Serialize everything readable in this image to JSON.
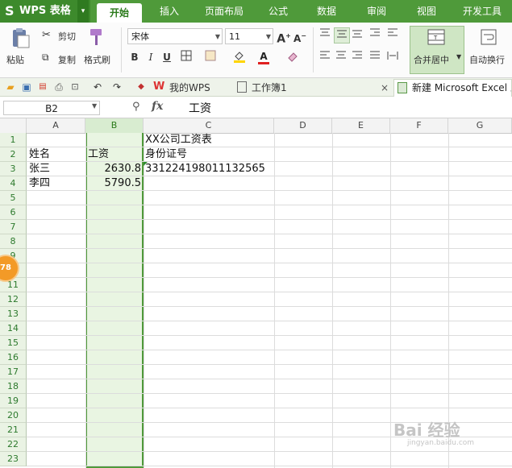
{
  "app": {
    "logo": "S",
    "name": "WPS 表格",
    "menu_arrow": "▾"
  },
  "menu_tabs": [
    {
      "label": "开始",
      "active": true
    },
    {
      "label": "插入"
    },
    {
      "label": "页面布局"
    },
    {
      "label": "公式"
    },
    {
      "label": "数据"
    },
    {
      "label": "审阅"
    },
    {
      "label": "视图"
    },
    {
      "label": "开发工具"
    }
  ],
  "ribbon": {
    "paste": "粘贴",
    "cut": "剪切",
    "copy": "复制",
    "format_painter": "格式刷",
    "font_name": "宋体",
    "font_size": "11",
    "bold": "B",
    "italic": "I",
    "underline": "U",
    "font_color_glyph": "A",
    "merge_center": "合并居中",
    "auto_wrap": "自动换行"
  },
  "doc_tabs": [
    {
      "label": "我的WPS"
    },
    {
      "label": "工作簿1"
    },
    {
      "label": "新建 Microsoft Excel 工"
    }
  ],
  "close_glyph": "×",
  "formula_bar": {
    "name_box": "B2",
    "fx": "fx",
    "content": "工资"
  },
  "columns": [
    "A",
    "B",
    "C",
    "D",
    "E",
    "F",
    "G"
  ],
  "rows": [
    "1",
    "2",
    "3",
    "4",
    "5",
    "6",
    "7",
    "8",
    "9",
    "10",
    "11",
    "12",
    "13",
    "14",
    "15",
    "16",
    "17",
    "18",
    "19",
    "20",
    "21",
    "22",
    "23"
  ],
  "cells": {
    "C1": "XX公司工资表",
    "A2": "姓名",
    "B2": "工资",
    "C2": "身份证号",
    "A3": "张三",
    "B3": "2630.8",
    "C3": "331224198011132565",
    "A4": "李四",
    "B4": "5790.5"
  },
  "badge": "78",
  "watermark": {
    "text": "Bai 经验",
    "url": "jingyan.baidu.com"
  },
  "colors": {
    "accent": "#4f9a3a",
    "selection": "#e9f5e2"
  }
}
